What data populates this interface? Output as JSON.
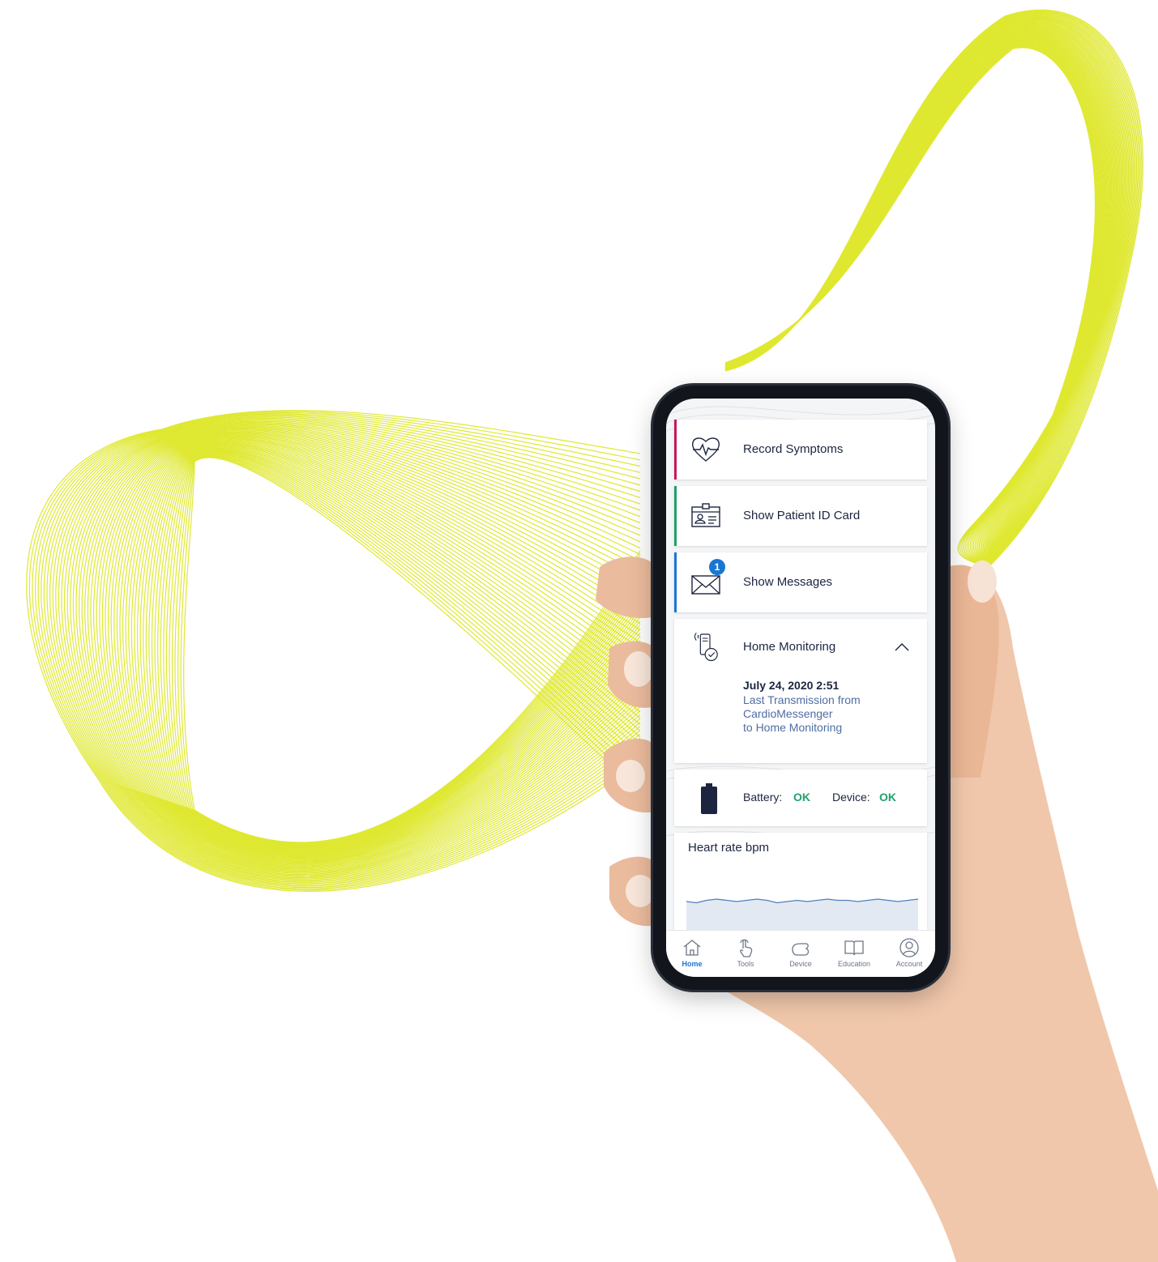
{
  "home": {
    "cards": [
      {
        "label": "Record Symptoms",
        "icon": "heart-pulse-icon"
      },
      {
        "label": "Show Patient ID Card",
        "icon": "id-card-icon"
      },
      {
        "label": "Show Messages",
        "icon": "envelope-icon",
        "badge": "1"
      }
    ],
    "home_monitoring": {
      "title": "Home Monitoring",
      "icon": "monitor-device-check-icon",
      "date": "July 24, 2020 2:51",
      "description_lines": [
        "Last Transmission from",
        "CardioMessenger",
        "to Home Monitoring"
      ]
    },
    "status": {
      "battery_label": "Battery:",
      "battery_value": "OK",
      "device_label": "Device:",
      "device_value": "OK"
    }
  },
  "chart_data": {
    "type": "area",
    "title": "Heart rate bpm",
    "values": [
      60,
      59,
      61,
      62,
      61,
      60,
      61,
      62,
      61,
      59,
      60,
      61,
      60,
      61,
      62,
      61,
      61,
      60,
      61,
      62,
      61,
      60,
      61,
      62
    ]
  },
  "tabbar": {
    "items": [
      {
        "label": "Home",
        "icon": "home-icon",
        "active": true
      },
      {
        "label": "Tools",
        "icon": "touch-icon",
        "active": false
      },
      {
        "label": "Device",
        "icon": "device-icon",
        "active": false
      },
      {
        "label": "Education",
        "icon": "book-icon",
        "active": false
      },
      {
        "label": "Account",
        "icon": "account-icon",
        "active": false
      }
    ]
  },
  "colors": {
    "accent": "#1976d2",
    "ok_green": "#22a06b",
    "symptom_accent": "#c2185b",
    "wave": "#dfe830"
  }
}
